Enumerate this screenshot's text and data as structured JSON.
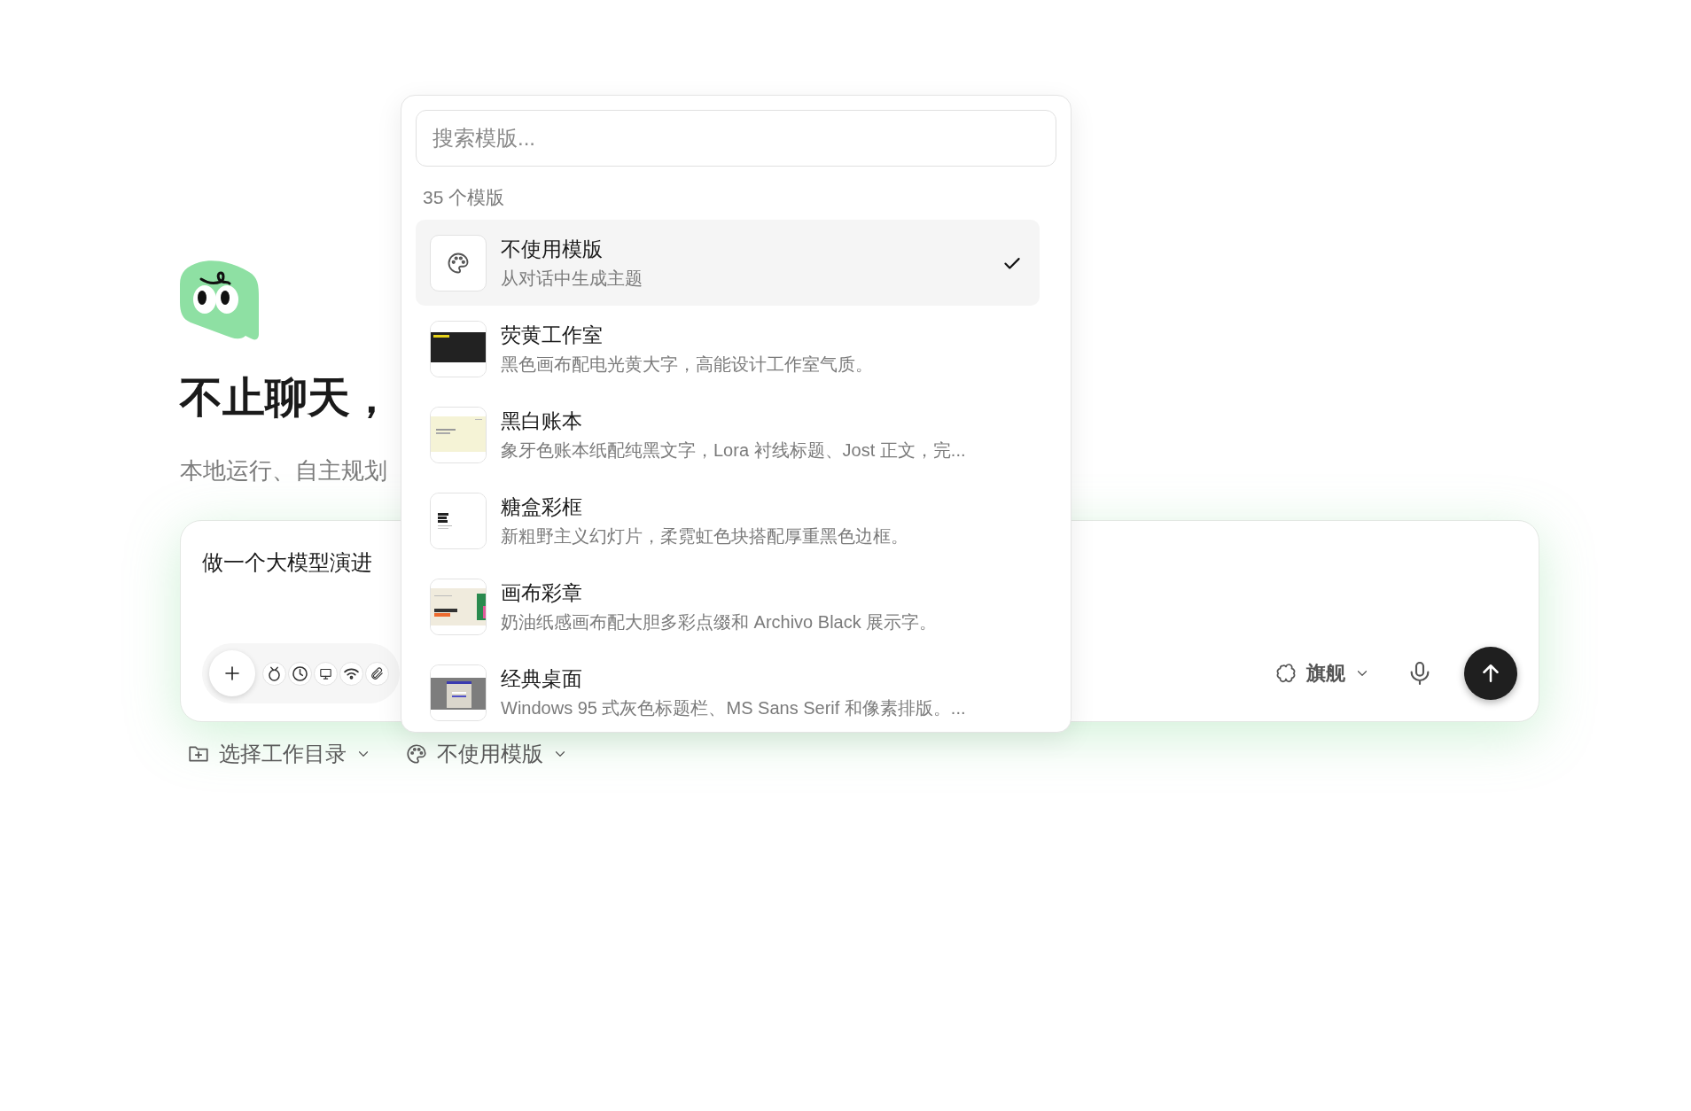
{
  "hero": {
    "title": "不止聊天，",
    "subtitle": "本地运行、自主规划"
  },
  "composer": {
    "value": "做一个大模型演进",
    "model": "旗舰"
  },
  "footer": {
    "workdir": "选择工作目录",
    "template": "不使用模版"
  },
  "template_menu": {
    "placeholder": "搜索模版...",
    "count": "35 个模版",
    "items": [
      {
        "kind": "icon",
        "title": "不使用模版",
        "description": "从对话中生成主题",
        "selected": true
      },
      {
        "kind": "picture",
        "title": "荧黄工作室",
        "description": "黑色画布配电光黄大字，高能设计工作室气质。",
        "selected": false
      },
      {
        "kind": "picture",
        "title": "黑白账本",
        "description": "象牙色账本纸配纯黑文字，Lora 衬线标题、Jost 正文，完...",
        "selected": false
      },
      {
        "kind": "picture",
        "title": "糖盒彩框",
        "description": "新粗野主义幻灯片，柔霓虹色块搭配厚重黑色边框。",
        "selected": false
      },
      {
        "kind": "picture",
        "title": "画布彩章",
        "description": "奶油纸感画布配大胆多彩点缀和 Archivo Black 展示字。",
        "selected": false
      },
      {
        "kind": "picture",
        "title": "经典桌面",
        "description": "Windows 95 式灰色标题栏、MS Sans Serif 和像素排版。...",
        "selected": false
      }
    ]
  }
}
